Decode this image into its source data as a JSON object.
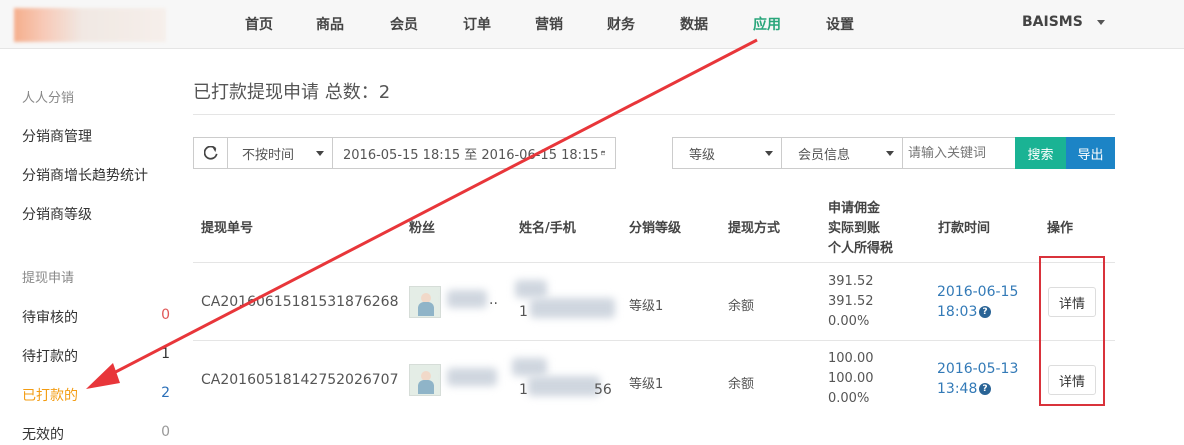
{
  "nav": {
    "items": [
      {
        "label": "首页"
      },
      {
        "label": "商品"
      },
      {
        "label": "会员"
      },
      {
        "label": "订单"
      },
      {
        "label": "营销"
      },
      {
        "label": "财务"
      },
      {
        "label": "数据"
      },
      {
        "label": "应用"
      },
      {
        "label": "设置"
      }
    ],
    "active": "应用",
    "user": "BAISMS"
  },
  "sidebar": {
    "section1": "人人分销",
    "links1": [
      "分销商管理",
      "分销商增长趋势统计",
      "分销商等级"
    ],
    "section2": "提现申请",
    "links2": [
      {
        "label": "待审核的",
        "count": "0",
        "color": "#e05656"
      },
      {
        "label": "待打款的",
        "count": "1",
        "color": "#333333"
      },
      {
        "label": "已打款的",
        "count": "2",
        "color": "#2a6fb8"
      },
      {
        "label": "无效的",
        "count": "0",
        "color": "#999999"
      }
    ]
  },
  "main": {
    "title": "已打款提现申请 总数：2",
    "filters": {
      "time_select": "不按时间",
      "date_range": "2016-05-15 18:15 至 2016-06-15 18:15",
      "level_select": "等级",
      "member_select": "会员信息",
      "keyword_placeholder": "请输入关键词",
      "search": "搜索",
      "export": "导出"
    },
    "table": {
      "headers": [
        "提现单号",
        "粉丝",
        "姓名/手机",
        "分销等级",
        "提现方式",
        "申请佣金",
        "实际到账",
        "个人所得税",
        "打款时间",
        "操作"
      ],
      "rows": [
        {
          "order": "CA20160615181531876268",
          "phone_frag": "1",
          "level": "等级1",
          "method": "余额",
          "apply": "391.52",
          "actual": "391.52",
          "tax": "0.00%",
          "date": "2016-06-15",
          "time": "18:03",
          "action": "详情"
        },
        {
          "order": "CA20160518142752026707",
          "phone_frag": "1",
          "phone_tail": "56",
          "level": "等级1",
          "method": "余额",
          "apply": "100.00",
          "actual": "100.00",
          "tax": "0.00%",
          "date": "2016-05-13",
          "time": "13:48",
          "action": "详情"
        }
      ]
    }
  },
  "colors": {
    "accent": "#1ab394",
    "export": "#1c84c6",
    "active_nav": "#2aa67b",
    "annotation": "#e8363a"
  },
  "icons": {
    "refresh": "refresh-icon",
    "calendar": "calendar-icon",
    "help": "question-circle-icon",
    "caret": "caret-down-icon"
  }
}
